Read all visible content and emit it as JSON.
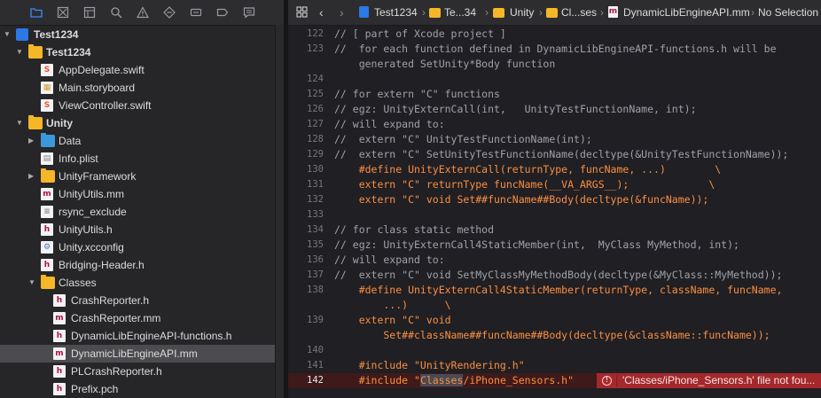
{
  "navigator": {
    "toolbar_icons": [
      "folder-icon",
      "source-control-icon",
      "hierarchy-icon",
      "find-icon",
      "issue-icon",
      "test-icon",
      "debug-icon",
      "breakpoint-icon",
      "report-icon"
    ],
    "tree": [
      {
        "label": "Test1234",
        "type": "project",
        "level": 0,
        "expanded": true
      },
      {
        "label": "Test1234",
        "type": "folder",
        "level": 1,
        "expanded": true
      },
      {
        "label": "AppDelegate.swift",
        "type": "swift",
        "level": 2
      },
      {
        "label": "Main.storyboard",
        "type": "storyboard",
        "level": 2
      },
      {
        "label": "ViewController.swift",
        "type": "swift",
        "level": 2
      },
      {
        "label": "Unity",
        "type": "folder",
        "level": 1,
        "expanded": true
      },
      {
        "label": "Data",
        "type": "folder-blue",
        "level": 2,
        "expanded": false
      },
      {
        "label": "Info.plist",
        "type": "plist",
        "level": 2
      },
      {
        "label": "UnityFramework",
        "type": "folder",
        "level": 2,
        "expanded": false
      },
      {
        "label": "UnityUtils.mm",
        "type": "mm",
        "level": 2
      },
      {
        "label": "rsync_exclude",
        "type": "text",
        "level": 2
      },
      {
        "label": "UnityUtils.h",
        "type": "h",
        "level": 2
      },
      {
        "label": "Unity.xcconfig",
        "type": "xcconfig",
        "level": 2
      },
      {
        "label": "Bridging-Header.h",
        "type": "h",
        "level": 2
      },
      {
        "label": "Classes",
        "type": "folder",
        "level": 2,
        "expanded": true
      },
      {
        "label": "CrashReporter.h",
        "type": "h",
        "level": 3
      },
      {
        "label": "CrashReporter.mm",
        "type": "mm",
        "level": 3
      },
      {
        "label": "DynamicLibEngineAPI-functions.h",
        "type": "h",
        "level": 3
      },
      {
        "label": "DynamicLibEngineAPI.mm",
        "type": "mm",
        "level": 3,
        "selected": true
      },
      {
        "label": "PLCrashReporter.h",
        "type": "h",
        "level": 3
      },
      {
        "label": "Prefix.pch",
        "type": "h",
        "level": 3
      }
    ]
  },
  "jumpbar": {
    "crumbs": [
      "Test1234",
      "Te...34",
      "Unity",
      "Cl...ses",
      "DynamicLibEngineAPI.mm",
      "No Selection"
    ]
  },
  "editor": {
    "lines": [
      {
        "n": "122",
        "segs": [
          {
            "t": "// [ part of Xcode project ]",
            "k": "c"
          }
        ]
      },
      {
        "n": "123",
        "segs": [
          {
            "t": "//  for each function defined in DynamicLibEngineAPI-functions.h will be",
            "k": "c"
          }
        ]
      },
      {
        "n": "",
        "segs": [
          {
            "t": "    generated SetUnity*Body function",
            "k": "c"
          }
        ]
      },
      {
        "n": "124",
        "segs": []
      },
      {
        "n": "125",
        "segs": [
          {
            "t": "// for extern \"C\" functions",
            "k": "c"
          }
        ]
      },
      {
        "n": "126",
        "segs": [
          {
            "t": "// egz: UnityExternCall(int,   UnityTestFunctionName, int);",
            "k": "c"
          }
        ]
      },
      {
        "n": "127",
        "segs": [
          {
            "t": "// will expand to:",
            "k": "c"
          }
        ]
      },
      {
        "n": "128",
        "segs": [
          {
            "t": "//  extern \"C\" UnityTestFunctionName(int);",
            "k": "c"
          }
        ]
      },
      {
        "n": "129",
        "segs": [
          {
            "t": "//  extern \"C\" SetUnityTestFunctionName(decltype(&UnityTestFunctionName));",
            "k": "c"
          }
        ]
      },
      {
        "n": "130",
        "segs": [
          {
            "t": "    #define UnityExternCall(returnType, funcName, ...)        \\",
            "k": "pp"
          }
        ]
      },
      {
        "n": "131",
        "segs": [
          {
            "t": "    extern \"C\" returnType funcName(__VA_ARGS__);             \\",
            "k": "pp"
          }
        ]
      },
      {
        "n": "132",
        "segs": [
          {
            "t": "    extern \"C\" void Set##funcName##Body(decltype(&funcName));",
            "k": "pp"
          }
        ]
      },
      {
        "n": "133",
        "segs": []
      },
      {
        "n": "134",
        "segs": [
          {
            "t": "// for class static method",
            "k": "c"
          }
        ]
      },
      {
        "n": "135",
        "segs": [
          {
            "t": "// egz: UnityExternCall4StaticMember(int,  MyClass MyMethod, int);",
            "k": "c"
          }
        ]
      },
      {
        "n": "136",
        "segs": [
          {
            "t": "// will expand to:",
            "k": "c"
          }
        ]
      },
      {
        "n": "137",
        "segs": [
          {
            "t": "//  extern \"C\" void SetMyClassMyMethodBody(decltype(&MyClass::MyMethod));",
            "k": "c"
          }
        ]
      },
      {
        "n": "138",
        "segs": [
          {
            "t": "    #define UnityExternCall4StaticMember(returnType, className, funcName,",
            "k": "pp"
          }
        ]
      },
      {
        "n": "",
        "segs": [
          {
            "t": "        ...)      \\",
            "k": "pp"
          }
        ]
      },
      {
        "n": "139",
        "segs": [
          {
            "t": "    extern \"C\" void",
            "k": "pp"
          }
        ]
      },
      {
        "n": "",
        "segs": [
          {
            "t": "        Set##className##funcName##Body(decltype(&className::funcName));",
            "k": "pp"
          }
        ]
      },
      {
        "n": "140",
        "segs": []
      },
      {
        "n": "141",
        "segs": [
          {
            "t": "    #include \"UnityRendering.h\"",
            "k": "pp"
          }
        ]
      },
      {
        "n": "142",
        "segs": [
          {
            "t": "    #include \"",
            "k": "pp"
          },
          {
            "t": "Classes",
            "k": "hl"
          },
          {
            "t": "/iPhone_Sensors.h\"",
            "k": "pp"
          }
        ]
      }
    ],
    "error": {
      "line": "142",
      "message": "'Classes/iPhone_Sensors.h' file not fou..."
    }
  },
  "colors": {
    "comment": "#a0a3a8",
    "preprocessor": "#fd8f3f",
    "error_banner": "#a4282c",
    "selection": "#4c4c50",
    "accent": "#3d8df5"
  }
}
